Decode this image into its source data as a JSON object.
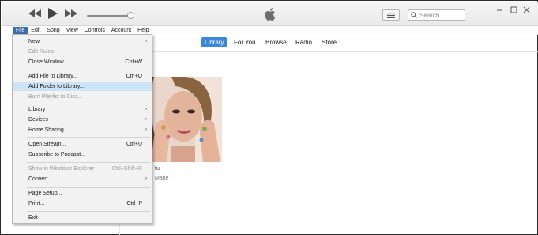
{
  "player": {
    "search_placeholder": "Search",
    "icons": [
      "previous-icon",
      "play-icon",
      "next-icon",
      "volume-slider",
      "apple-logo",
      "list-view-icon",
      "search-icon",
      "minimize-icon",
      "maximize-icon",
      "close-icon"
    ]
  },
  "menubar": {
    "items": [
      "File",
      "Edit",
      "Song",
      "View",
      "Controls",
      "Account",
      "Help"
    ],
    "active": "File"
  },
  "tabs": {
    "items": [
      "Library",
      "For You",
      "Browse",
      "Radio",
      "Store"
    ],
    "active": "Library"
  },
  "album": {
    "title_fragment": "ful",
    "artist_fragment": "Marie"
  },
  "file_menu": {
    "items": [
      {
        "label": "New",
        "shortcut": "",
        "submenu": true,
        "disabled": false
      },
      {
        "label": "Edit Rules",
        "shortcut": "",
        "submenu": false,
        "disabled": true
      },
      {
        "label": "Close Window",
        "shortcut": "Ctrl+W",
        "submenu": false,
        "disabled": false
      },
      {
        "label": "Add File to Library...",
        "shortcut": "Ctrl+O",
        "submenu": false,
        "disabled": false
      },
      {
        "label": "Add Folder to Library...",
        "shortcut": "",
        "submenu": false,
        "disabled": false,
        "highlighted": true
      },
      {
        "label": "Burn Playlist to Disc...",
        "shortcut": "",
        "submenu": false,
        "disabled": true
      },
      {
        "label": "Library",
        "shortcut": "",
        "submenu": true,
        "disabled": false
      },
      {
        "label": "Devices",
        "shortcut": "",
        "submenu": true,
        "disabled": false
      },
      {
        "label": "Home Sharing",
        "shortcut": "",
        "submenu": true,
        "disabled": false
      },
      {
        "label": "Open Stream...",
        "shortcut": "Ctrl+U",
        "submenu": false,
        "disabled": false
      },
      {
        "label": "Subscribe to Podcast...",
        "shortcut": "",
        "submenu": false,
        "disabled": false
      },
      {
        "label": "Show in Windows Explorer",
        "shortcut": "Ctrl+Shift+R",
        "submenu": false,
        "disabled": true
      },
      {
        "label": "Convert",
        "shortcut": "",
        "submenu": true,
        "disabled": false
      },
      {
        "label": "Page Setup...",
        "shortcut": "",
        "submenu": false,
        "disabled": false
      },
      {
        "label": "Print...",
        "shortcut": "Ctrl+P",
        "submenu": false,
        "disabled": false
      },
      {
        "label": "Exit",
        "shortcut": "",
        "submenu": false,
        "disabled": false
      }
    ],
    "submenu_arrow": "›"
  },
  "colors": {
    "accent": "#3a86d9",
    "menu_active": "#3a6ea5",
    "highlight": "#cde4f7",
    "disabled_text": "#9a9a9a"
  }
}
